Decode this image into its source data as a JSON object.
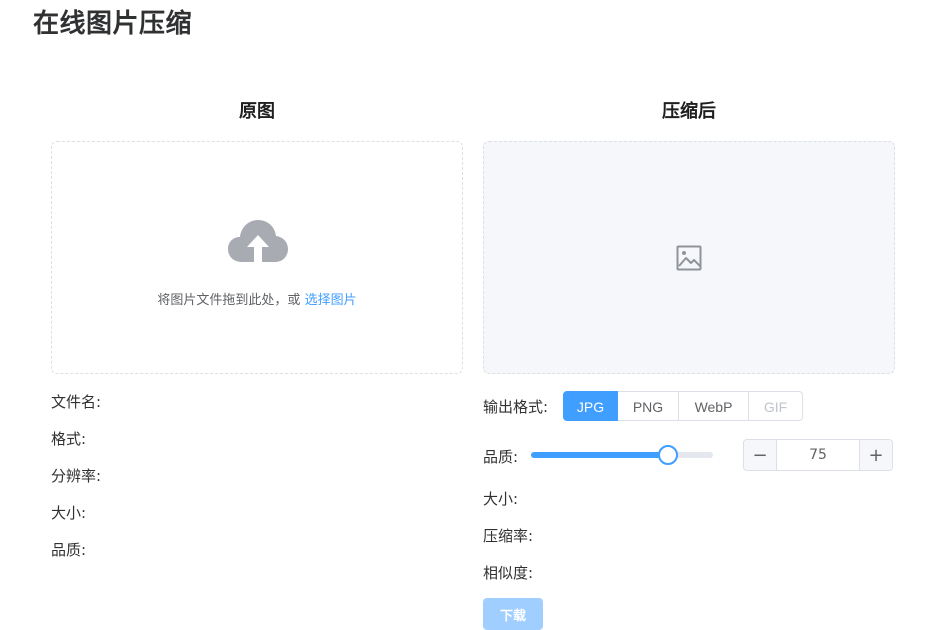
{
  "page": {
    "title": "在线图片压缩"
  },
  "original": {
    "title": "原图",
    "upload": {
      "hint": "将图片文件拖到此处，或",
      "link": "选择图片",
      "icon": "upload-cloud-icon"
    },
    "info": {
      "filename_label": "文件名:",
      "format_label": "格式:",
      "resolution_label": "分辨率:",
      "size_label": "大小:",
      "quality_label": "品质:"
    }
  },
  "compressed": {
    "title": "压缩后",
    "preview_icon": "picture-icon",
    "output_format": {
      "label": "输出格式:",
      "options": [
        "JPG",
        "PNG",
        "WebP",
        "GIF"
      ],
      "selected": "JPG",
      "disabled": [
        "GIF"
      ]
    },
    "quality": {
      "label": "品质:",
      "value": 75,
      "min": 0,
      "max": 100,
      "minus": "−",
      "plus": "+"
    },
    "info": {
      "size_label": "大小:",
      "ratio_label": "压缩率:",
      "similarity_label": "相似度:"
    },
    "download_label": "下载"
  },
  "colors": {
    "primary": "#409eff",
    "primary_disabled": "#a0cfff",
    "border": "#dcdfe6",
    "text": "#303133"
  }
}
